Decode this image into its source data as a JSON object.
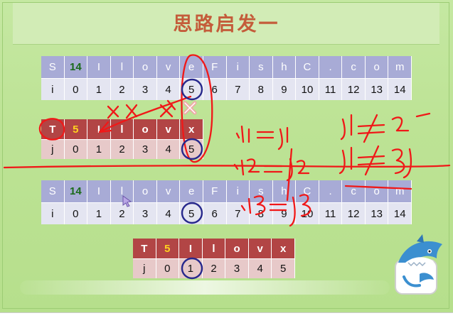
{
  "slide": {
    "title": "思路启发一"
  },
  "table_s_top": {
    "header": [
      "S",
      "14",
      "I",
      "l",
      "o",
      "v",
      "e",
      "F",
      "i",
      "s",
      "h",
      "C",
      ".",
      "c",
      "o",
      "m"
    ],
    "values": [
      "i",
      "0",
      "1",
      "2",
      "3",
      "4",
      "5",
      "6",
      "7",
      "8",
      "9",
      "10",
      "11",
      "12",
      "13",
      "14"
    ]
  },
  "table_t_top": {
    "header": [
      "T",
      "5",
      "I",
      "l",
      "o",
      "v",
      "x"
    ],
    "values": [
      "j",
      "0",
      "1",
      "2",
      "3",
      "4",
      "5"
    ]
  },
  "table_s_bottom": {
    "header": [
      "S",
      "14",
      "I",
      "l",
      "o",
      "v",
      "e",
      "F",
      "i",
      "s",
      "h",
      "C",
      ".",
      "c",
      "o",
      "m"
    ],
    "values": [
      "i",
      "0",
      "1",
      "2",
      "3",
      "4",
      "5",
      "6",
      "7",
      "8",
      "9",
      "10",
      "11",
      "12",
      "13",
      "14"
    ]
  },
  "table_t_bottom": {
    "header": [
      "T",
      "5",
      "I",
      "l",
      "o",
      "v",
      "x"
    ],
    "values": [
      "j",
      "0",
      "1",
      "2",
      "3",
      "4",
      "5"
    ]
  },
  "colors": {
    "background": "#bde395",
    "title": "#c45c3a",
    "s_header": "#a8abd6",
    "s_values": "#e4e5f1",
    "t_header": "#b24545",
    "t_values": "#e7c9c9",
    "length_s": "#1a6a1a",
    "length_t": "#ffd21f",
    "ink": "#f01818",
    "circle": "#27288c"
  },
  "icons": [
    "x-mark-icon",
    "pointer-cursor-icon",
    "shark-mascot-icon"
  ]
}
